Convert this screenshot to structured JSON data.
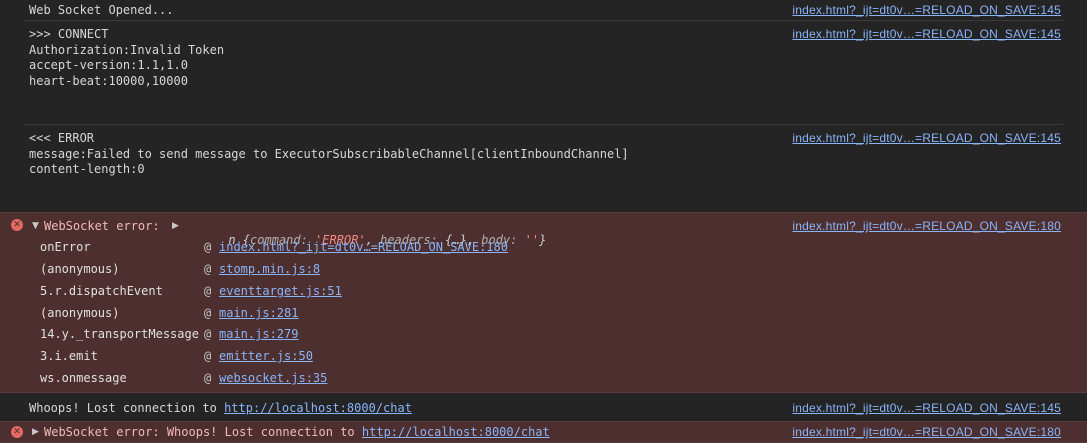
{
  "entries": {
    "ws_opened": {
      "text": "Web Socket Opened...",
      "source": "index.html?_ijt=dt0v…=RELOAD_ON_SAVE:145"
    },
    "connect": {
      "lines": [
        ">>> CONNECT",
        "Authorization:Invalid Token",
        "accept-version:1.1,1.0",
        "heart-beat:10000,10000"
      ],
      "source": "index.html?_ijt=dt0v…=RELOAD_ON_SAVE:145"
    },
    "error_frame": {
      "lines": [
        "<<< ERROR",
        "message:Failed to send message to ExecutorSubscribableChannel[clientInboundChannel]",
        "content-length:0"
      ],
      "source": "index.html?_ijt=dt0v…=RELOAD_ON_SAVE:145"
    },
    "ws_error": {
      "label": "WebSocket error:",
      "obj_prefix": "n {",
      "k_command": "command:",
      "v_command": "'ERROR'",
      "k_headers": "headers:",
      "v_headers": "{…},",
      "k_body": "body:",
      "v_body": "''",
      "obj_suffix": "}",
      "source": "index.html?_ijt=dt0v…=RELOAD_ON_SAVE:180",
      "stack": [
        {
          "fn": "onError",
          "link": "index.html?_ijt=dt0v…=RELOAD_ON_SAVE:180"
        },
        {
          "fn": "(anonymous)",
          "link": "stomp.min.js:8"
        },
        {
          "fn": "5.r.dispatchEvent",
          "link": "eventtarget.js:51"
        },
        {
          "fn": "(anonymous)",
          "link": "main.js:281"
        },
        {
          "fn": "14.y._transportMessage",
          "link": "main.js:279"
        },
        {
          "fn": "3.i.emit",
          "link": "emitter.js:50"
        },
        {
          "fn": "ws.onmessage",
          "link": "websocket.js:35"
        }
      ],
      "at_symbol": "@"
    },
    "lost": {
      "text": "Whoops! Lost connection to",
      "url": "http://localhost:8000/chat",
      "source": "index.html?_ijt=dt0v…=RELOAD_ON_SAVE:145"
    },
    "ws_error_collapsed": {
      "text": "WebSocket error: Whoops! Lost connection to",
      "url": "http://localhost:8000/chat",
      "source": "index.html?_ijt=dt0v…=RELOAD_ON_SAVE:180"
    }
  },
  "icons": {
    "error": "error-circle-icon",
    "expand": "triangle-expand-icon",
    "collapse": "triangle-collapse-icon"
  },
  "glyphs": {
    "error_x": "✕",
    "tri_down": "▼",
    "tri_right": "▶"
  },
  "colors": {
    "background": "#242424",
    "error_background": "#4d2f30",
    "link": "#8ab4f8",
    "error_icon": "#e46962"
  }
}
